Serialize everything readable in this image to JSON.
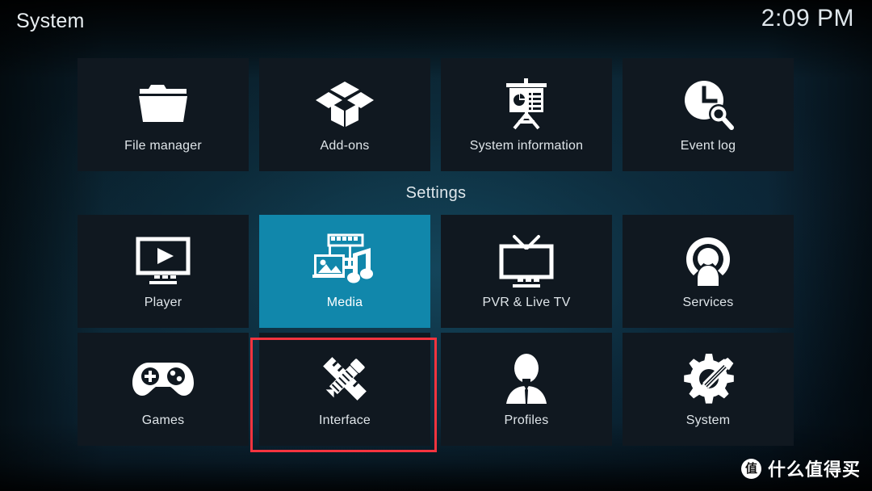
{
  "header": {
    "title": "System",
    "clock": "2:09 PM"
  },
  "colors": {
    "focus": "#1187ab",
    "annotation": "#f4343f",
    "tile_background": "#101820",
    "text": "#dfe5e9"
  },
  "section": {
    "settings_label": "Settings"
  },
  "rows": [
    {
      "name": "top-row",
      "tiles": [
        {
          "label": "File manager",
          "icon": "folder-icon",
          "focused": false
        },
        {
          "label": "Add-ons",
          "icon": "open-box-icon",
          "focused": false
        },
        {
          "label": "System information",
          "icon": "presentation-board-icon",
          "focused": false
        },
        {
          "label": "Event log",
          "icon": "clock-search-icon",
          "focused": false
        }
      ]
    },
    {
      "name": "settings-row-1",
      "tiles": [
        {
          "label": "Player",
          "icon": "monitor-play-icon",
          "focused": false
        },
        {
          "label": "Media",
          "icon": "media-filmstrip-photo-music-icon",
          "focused": true
        },
        {
          "label": "PVR & Live TV",
          "icon": "tv-antenna-icon",
          "focused": false
        },
        {
          "label": "Services",
          "icon": "person-broadcast-icon",
          "focused": false
        }
      ]
    },
    {
      "name": "settings-row-2",
      "tiles": [
        {
          "label": "Games",
          "icon": "gamepad-icon",
          "focused": false
        },
        {
          "label": "Interface",
          "icon": "pencil-ruler-icon",
          "focused": false,
          "annotated": true
        },
        {
          "label": "Profiles",
          "icon": "person-bust-icon",
          "focused": false
        },
        {
          "label": "System",
          "icon": "gear-screwdriver-icon",
          "focused": false
        }
      ]
    }
  ],
  "watermark": {
    "badge": "值",
    "text": "什么值得买"
  }
}
